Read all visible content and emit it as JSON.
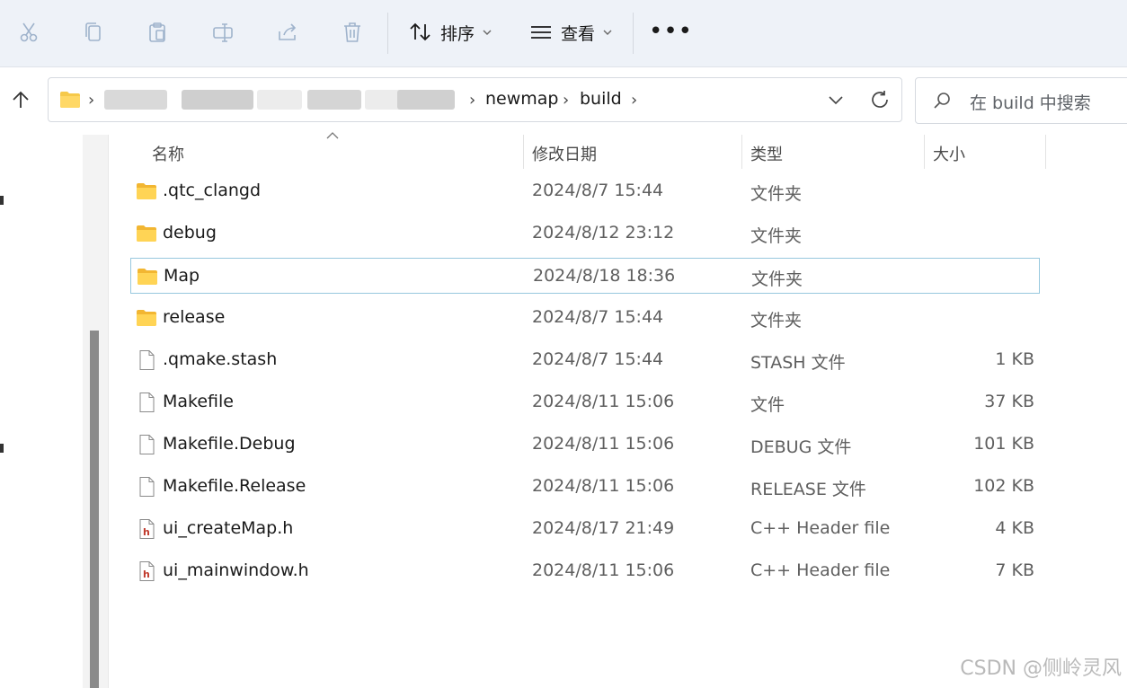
{
  "toolbar": {
    "icons": [
      "cut-icon",
      "copy-icon",
      "paste-icon",
      "rename-icon",
      "share-icon",
      "delete-icon"
    ],
    "sort_label": "排序",
    "view_label": "查看",
    "more_label": "•••"
  },
  "address": {
    "crumbs": [
      "newmap",
      "build"
    ],
    "separator": "›"
  },
  "search": {
    "placeholder": "在 build 中搜索"
  },
  "columns": {
    "name": "名称",
    "date": "修改日期",
    "type": "类型",
    "size": "大小"
  },
  "files": [
    {
      "name": ".qtc_clangd",
      "date": "2024/8/7 15:44",
      "type": "文件夹",
      "size": "",
      "icon": "folder-icon"
    },
    {
      "name": "debug",
      "date": "2024/8/12 23:12",
      "type": "文件夹",
      "size": "",
      "icon": "folder-icon"
    },
    {
      "name": "Map",
      "date": "2024/8/18 18:36",
      "type": "文件夹",
      "size": "",
      "icon": "folder-icon"
    },
    {
      "name": "release",
      "date": "2024/8/7 15:44",
      "type": "文件夹",
      "size": "",
      "icon": "folder-icon"
    },
    {
      "name": ".qmake.stash",
      "date": "2024/8/7 15:44",
      "type": "STASH 文件",
      "size": "1 KB",
      "icon": "file-icon"
    },
    {
      "name": "Makefile",
      "date": "2024/8/11 15:06",
      "type": "文件",
      "size": "37 KB",
      "icon": "file-icon"
    },
    {
      "name": "Makefile.Debug",
      "date": "2024/8/11 15:06",
      "type": "DEBUG 文件",
      "size": "101 KB",
      "icon": "file-icon"
    },
    {
      "name": "Makefile.Release",
      "date": "2024/8/11 15:06",
      "type": "RELEASE 文件",
      "size": "102 KB",
      "icon": "file-icon"
    },
    {
      "name": "ui_createMap.h",
      "date": "2024/8/17 21:49",
      "type": "C++ Header file",
      "size": "4 KB",
      "icon": "header-file-icon"
    },
    {
      "name": "ui_mainwindow.h",
      "date": "2024/8/11 15:06",
      "type": "C++ Header file",
      "size": "7 KB",
      "icon": "header-file-icon"
    }
  ],
  "selected_index": 2,
  "watermark": "CSDN @侧岭灵风",
  "colors": {
    "toolbar_bg": "#eef2f8",
    "folder": "#f6c94a",
    "selection_border": "#98c8de",
    "header_icon": "#c0392b"
  }
}
